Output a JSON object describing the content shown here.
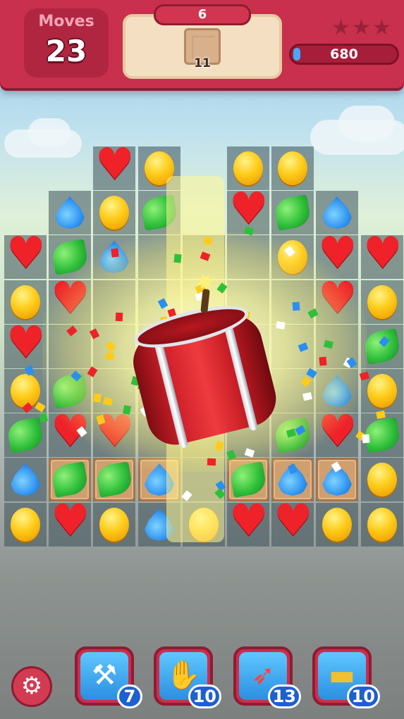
{
  "hud": {
    "moves_label": "Moves",
    "moves_value": "23",
    "level": "6",
    "goal": {
      "icon": "wooden-crate-icon",
      "count": "11"
    },
    "stars": {
      "earned": 0,
      "total": 3
    },
    "score": "680",
    "score_progress": 0.05
  },
  "board": {
    "columns": 9,
    "rows": 10,
    "cells": [
      {
        "r": 0,
        "c": 2,
        "candy": "heart"
      },
      {
        "r": 0,
        "c": 3,
        "candy": "yellow"
      },
      {
        "r": 0,
        "c": 5,
        "candy": "yellow"
      },
      {
        "r": 0,
        "c": 6,
        "candy": "yellow"
      },
      {
        "r": 1,
        "c": 1,
        "candy": "blue"
      },
      {
        "r": 1,
        "c": 2,
        "candy": "yellow"
      },
      {
        "r": 1,
        "c": 3,
        "candy": "green"
      },
      {
        "r": 1,
        "c": 5,
        "candy": "heart"
      },
      {
        "r": 1,
        "c": 6,
        "candy": "green"
      },
      {
        "r": 1,
        "c": 7,
        "candy": "blue"
      },
      {
        "r": 2,
        "c": 0,
        "candy": "heart"
      },
      {
        "r": 2,
        "c": 1,
        "candy": "green"
      },
      {
        "r": 2,
        "c": 2,
        "candy": "blue"
      },
      {
        "r": 2,
        "c": 6,
        "candy": "yellow"
      },
      {
        "r": 2,
        "c": 7,
        "candy": "heart"
      },
      {
        "r": 2,
        "c": 8,
        "candy": "heart"
      },
      {
        "r": 3,
        "c": 0,
        "candy": "yellow"
      },
      {
        "r": 3,
        "c": 1,
        "candy": "heart"
      },
      {
        "r": 3,
        "c": 7,
        "candy": "heart"
      },
      {
        "r": 3,
        "c": 8,
        "candy": "yellow"
      },
      {
        "r": 4,
        "c": 0,
        "candy": "heart"
      },
      {
        "r": 4,
        "c": 8,
        "candy": "green"
      },
      {
        "r": 5,
        "c": 0,
        "candy": "yellow"
      },
      {
        "r": 5,
        "c": 1,
        "candy": "green"
      },
      {
        "r": 5,
        "c": 7,
        "candy": "blue"
      },
      {
        "r": 5,
        "c": 8,
        "candy": "yellow"
      },
      {
        "r": 6,
        "c": 0,
        "candy": "green"
      },
      {
        "r": 6,
        "c": 1,
        "candy": "heart"
      },
      {
        "r": 6,
        "c": 2,
        "candy": "heart"
      },
      {
        "r": 6,
        "c": 6,
        "candy": "green"
      },
      {
        "r": 6,
        "c": 7,
        "candy": "heart"
      },
      {
        "r": 6,
        "c": 8,
        "candy": "green"
      },
      {
        "r": 7,
        "c": 0,
        "candy": "blue"
      },
      {
        "r": 7,
        "c": 1,
        "candy": "green",
        "crate": true
      },
      {
        "r": 7,
        "c": 2,
        "candy": "green",
        "crate": true
      },
      {
        "r": 7,
        "c": 3,
        "candy": "blue",
        "crate": true
      },
      {
        "r": 7,
        "c": 5,
        "candy": "green",
        "crate": true
      },
      {
        "r": 7,
        "c": 6,
        "candy": "blue",
        "crate": true
      },
      {
        "r": 7,
        "c": 7,
        "candy": "blue",
        "crate": true
      },
      {
        "r": 7,
        "c": 8,
        "candy": "yellow"
      },
      {
        "r": 8,
        "c": 0,
        "candy": "yellow"
      },
      {
        "r": 8,
        "c": 1,
        "candy": "heart"
      },
      {
        "r": 8,
        "c": 2,
        "candy": "yellow"
      },
      {
        "r": 8,
        "c": 3,
        "candy": "blue"
      },
      {
        "r": 8,
        "c": 4,
        "candy": "yellow"
      },
      {
        "r": 8,
        "c": 5,
        "candy": "heart"
      },
      {
        "r": 8,
        "c": 6,
        "candy": "heart"
      },
      {
        "r": 8,
        "c": 7,
        "candy": "yellow"
      },
      {
        "r": 8,
        "c": 8,
        "candy": "yellow"
      }
    ],
    "empty_cells": [
      {
        "r": 2,
        "c": 3
      },
      {
        "r": 2,
        "c": 4
      },
      {
        "r": 2,
        "c": 5
      },
      {
        "r": 3,
        "c": 2
      },
      {
        "r": 3,
        "c": 3
      },
      {
        "r": 3,
        "c": 4
      },
      {
        "r": 3,
        "c": 5
      },
      {
        "r": 3,
        "c": 6
      },
      {
        "r": 4,
        "c": 1
      },
      {
        "r": 4,
        "c": 2
      },
      {
        "r": 4,
        "c": 3
      },
      {
        "r": 4,
        "c": 4
      },
      {
        "r": 4,
        "c": 5
      },
      {
        "r": 4,
        "c": 6
      },
      {
        "r": 4,
        "c": 7
      },
      {
        "r": 5,
        "c": 2
      },
      {
        "r": 5,
        "c": 3
      },
      {
        "r": 5,
        "c": 4
      },
      {
        "r": 5,
        "c": 5
      },
      {
        "r": 5,
        "c": 6
      },
      {
        "r": 6,
        "c": 3
      },
      {
        "r": 6,
        "c": 4
      },
      {
        "r": 6,
        "c": 5
      },
      {
        "r": 7,
        "c": 4
      },
      {
        "r": 0,
        "c": 0
      },
      {
        "r": 0,
        "c": 1
      },
      {
        "r": 1,
        "c": 0
      },
      {
        "r": 0,
        "c": 7
      },
      {
        "r": 0,
        "c": 8
      },
      {
        "r": 1,
        "c": 8
      }
    ],
    "effect": "barrel-bomb-explosion"
  },
  "boosters": [
    {
      "name": "hammer",
      "icon": "hammer-icon",
      "count": "7"
    },
    {
      "name": "hand",
      "icon": "hand-icon",
      "count": "10"
    },
    {
      "name": "rocket",
      "icon": "firework-rocket-icon",
      "count": "13"
    },
    {
      "name": "skateboard",
      "icon": "skateboard-icon",
      "count": "10"
    }
  ],
  "settings": {
    "icon": "gear-icon"
  },
  "colors": {
    "bar_red": "#c8304d",
    "heart_red": "#ee2228",
    "candy_yellow": "#fecb18",
    "candy_blue": "#2a8ff0",
    "candy_green": "#2fc03a",
    "crate_wood": "#cf9f6f",
    "score_blue": "#4aa7ff"
  }
}
